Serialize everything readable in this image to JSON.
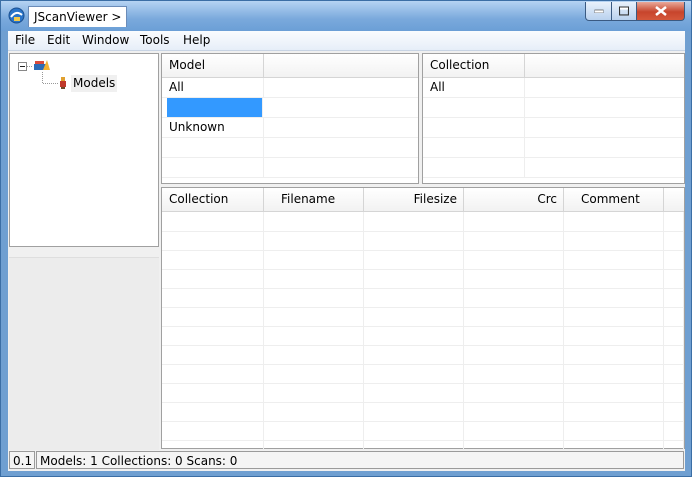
{
  "window": {
    "title": "JScanViewer >",
    "colors": {
      "title_gradient_top": "#b5d3f3",
      "selection": "#3399ff",
      "close_button": "#c7452c"
    }
  },
  "menu": [
    "File",
    "Edit",
    "Window",
    "Tools",
    "Help"
  ],
  "tree": {
    "root_icon": "collection-icon",
    "child_icon": "model-icon",
    "child_label": "Models"
  },
  "models_table": {
    "header": "Model",
    "rows": [
      "All",
      "",
      "Unknown",
      "",
      ""
    ],
    "selected_row": 1
  },
  "collections_table": {
    "header": "Collection",
    "rows": [
      "All",
      "",
      "",
      "",
      ""
    ]
  },
  "scans_table": {
    "headers": [
      "Collection",
      "Filename",
      "Filesize",
      "Crc",
      "Comment"
    ],
    "row_count": 13
  },
  "status": {
    "version": "0.1",
    "summary": "Models: 1 Collections: 0 Scans: 0"
  }
}
